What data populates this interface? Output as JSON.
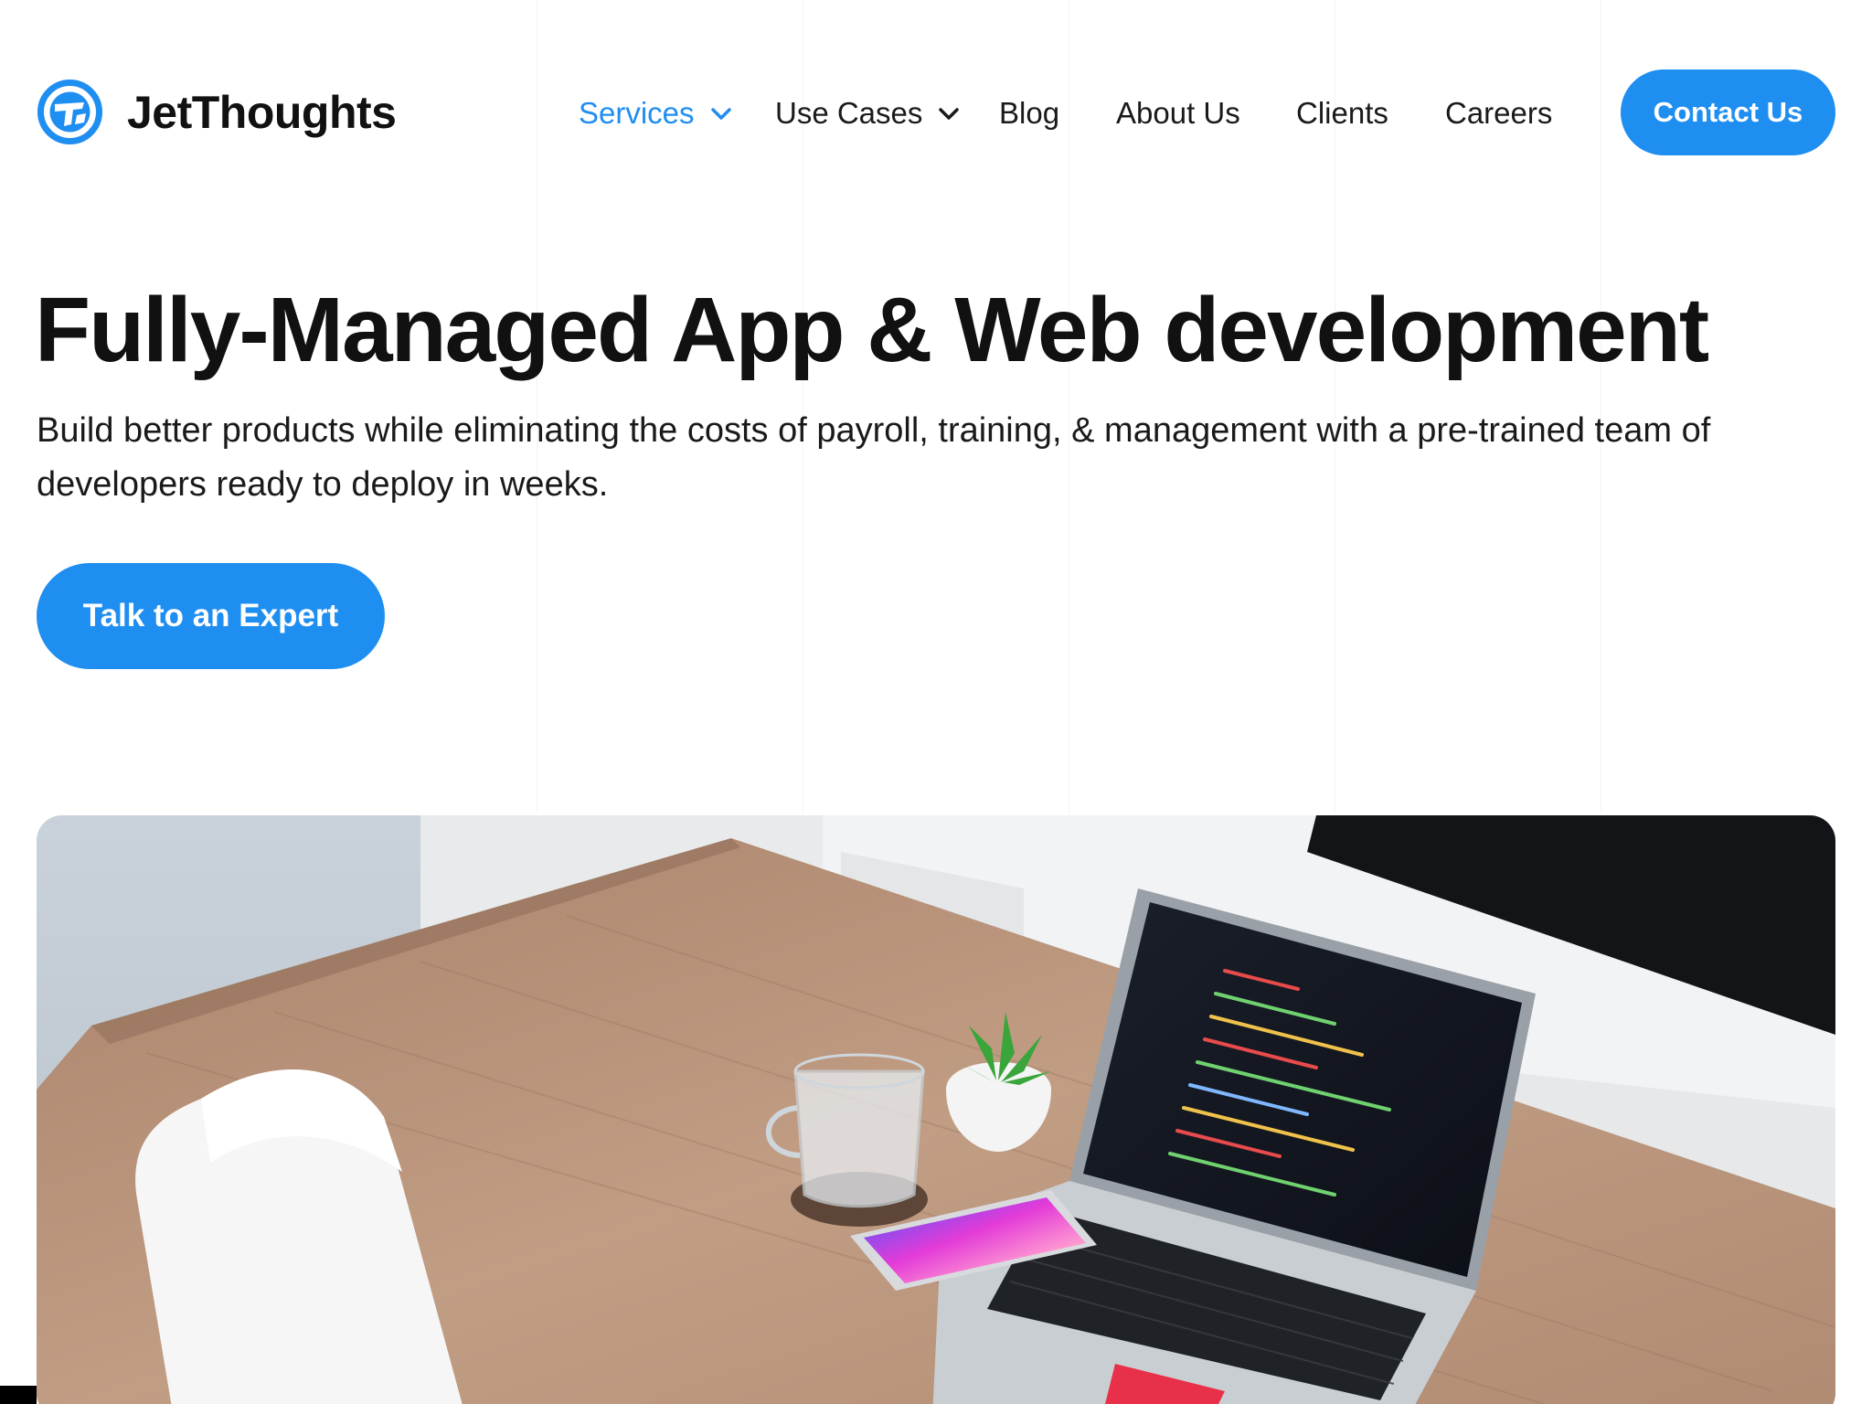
{
  "brand": {
    "name": "JetThoughts",
    "accent": "#1f8ef1",
    "logo_icon": "jetthoughts-logo-icon"
  },
  "nav": {
    "items": [
      {
        "label": "Services",
        "dropdown": true,
        "active": true
      },
      {
        "label": "Use Cases",
        "dropdown": true,
        "active": false
      },
      {
        "label": "Blog",
        "dropdown": false,
        "active": false
      },
      {
        "label": "About Us",
        "dropdown": false,
        "active": false
      },
      {
        "label": "Clients",
        "dropdown": false,
        "active": false
      },
      {
        "label": "Careers",
        "dropdown": false,
        "active": false
      }
    ],
    "contact_label": "Contact Us"
  },
  "hero": {
    "title": "Fully-Managed App & Web development",
    "subtitle": "Build better products while eliminating the costs of payroll, training, & management with a pre-trained team of developers ready to deploy in weeks.",
    "cta_label": "Talk to an Expert"
  },
  "colors": {
    "text": "#111111",
    "button_text": "#ffffff",
    "background": "#ffffff"
  }
}
